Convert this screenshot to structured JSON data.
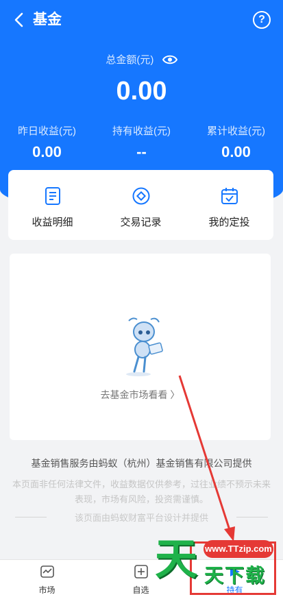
{
  "header": {
    "title": "基金",
    "back_icon": "chevron-left-icon",
    "help_icon": "question-circle-icon",
    "help_glyph": "?"
  },
  "summary": {
    "total_label": "总金额(元)",
    "total_value": "0.00",
    "stats": [
      {
        "label": "昨日收益(元)",
        "value": "0.00"
      },
      {
        "label": "持有收益(元)",
        "value": "--"
      },
      {
        "label": "累计收益(元)",
        "value": "0.00"
      }
    ]
  },
  "shortcuts": [
    {
      "label": "收益明细",
      "icon": "document-icon"
    },
    {
      "label": "交易记录",
      "icon": "diamond-circle-icon"
    },
    {
      "label": "我的定投",
      "icon": "calendar-check-icon"
    }
  ],
  "empty_state": {
    "link_text": "去基金市场看看 〉"
  },
  "footer": {
    "provider": "基金销售服务由蚂蚁（杭州）基金销售有限公司提供",
    "disclaimer": "本页面非任何法律文件，收益数据仅供参考，过往业绩不预示未来表现，市场有风险，投资需谨慎。",
    "design_note": "该页面由蚂蚁财富平台设计并提供"
  },
  "tabs": [
    {
      "label": "市场",
      "icon": "market-icon",
      "active": false
    },
    {
      "label": "自选",
      "icon": "plus-square-icon",
      "active": false
    },
    {
      "label": "持有",
      "icon": "holdings-icon",
      "active": true
    }
  ],
  "watermark": {
    "site": "www.TTzip.com",
    "big_char": "天",
    "text": "天下载"
  },
  "colors": {
    "brand_blue": "#1677ff",
    "annotation_red": "#e53935",
    "watermark_green": "#1fb24a"
  }
}
